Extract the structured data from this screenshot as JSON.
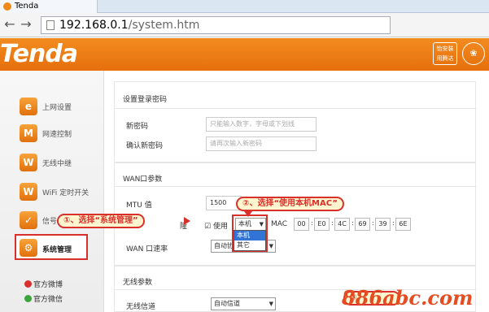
{
  "browser": {
    "tab_title": "Tenda",
    "url_host": "192.168.0.1",
    "url_path": "/system.htm"
  },
  "header": {
    "logo": "Tenda",
    "badge_line1": "怡安装",
    "badge_line2": "用腾达"
  },
  "sidebar": {
    "items": [
      {
        "label": "上网设置",
        "icon": "e"
      },
      {
        "label": "网速控制",
        "icon": "M"
      },
      {
        "label": "无线中继",
        "icon": "W"
      },
      {
        "label": "WiFi 定时开关",
        "icon": "W"
      },
      {
        "label": "信号",
        "icon": "✓"
      },
      {
        "label": "系统管理",
        "icon": "⚙"
      }
    ],
    "social": [
      {
        "label": "官方微博"
      },
      {
        "label": "官方微信"
      }
    ]
  },
  "main": {
    "login_section": {
      "title": "设置登录密码",
      "new_password_label": "新密码",
      "new_password_placeholder": "只能输入数字，字母或下划线",
      "confirm_label": "确认新密码",
      "confirm_placeholder": "请再次输入新密码"
    },
    "wan_section": {
      "title": "WAN口参数",
      "mtu_label": "MTU 值",
      "mtu_value": "1500",
      "mac_label_suffix": "隆",
      "use_checkbox_label": "使用",
      "mac_select_value": "本机",
      "mac_label": "MAC",
      "mac": [
        "00",
        "E0",
        "4C",
        "69",
        "39",
        "6E"
      ],
      "speed_label": "WAN 口速率",
      "speed_value": "自动协商",
      "mac_options": [
        "本机",
        "其它"
      ]
    },
    "wireless_section": {
      "title": "无线参数",
      "channel_label": "无线信道",
      "channel_value": "自动信道"
    }
  },
  "annotations": {
    "step1": "①、选择“系统管理”",
    "step2": "②、选择“使用本机MAC”",
    "step3": "③"
  },
  "watermark": "886abc.com",
  "colors": {
    "brand_orange": "#f28b1f",
    "annotation_red": "#d9302b",
    "callout_fill": "#fff6cf"
  }
}
